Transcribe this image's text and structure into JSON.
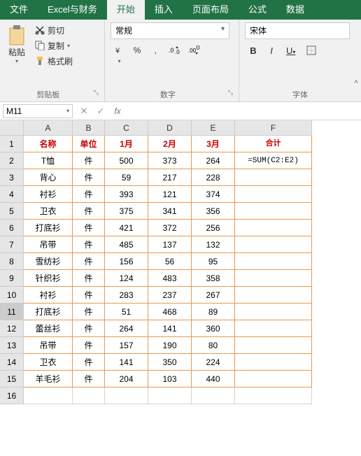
{
  "ribbon": {
    "tabs": [
      "文件",
      "Excel与财务",
      "开始",
      "插入",
      "页面布局",
      "公式",
      "数据"
    ],
    "active_tab_index": 2,
    "clipboard": {
      "paste": "粘贴",
      "cut": "剪切",
      "copy": "复制",
      "format_painter": "格式刷",
      "group_label": "剪贴板"
    },
    "number": {
      "format_select": "常规",
      "group_label": "数字"
    },
    "font": {
      "font_select": "宋体",
      "bold": "B",
      "italic": "I",
      "underline": "U",
      "group_label": "字体"
    }
  },
  "name_box": "M11",
  "formula_input": "",
  "grid": {
    "columns": [
      "A",
      "B",
      "C",
      "D",
      "E",
      "F"
    ],
    "header": [
      "名称",
      "单位",
      "1月",
      "2月",
      "3月",
      "合计"
    ],
    "rows": [
      [
        "T恤",
        "件",
        "500",
        "373",
        "264",
        "=SUM(C2:E2)"
      ],
      [
        "背心",
        "件",
        "59",
        "217",
        "228",
        ""
      ],
      [
        "衬衫",
        "件",
        "393",
        "121",
        "374",
        ""
      ],
      [
        "卫衣",
        "件",
        "375",
        "341",
        "356",
        ""
      ],
      [
        "打底衫",
        "件",
        "421",
        "372",
        "256",
        ""
      ],
      [
        "吊带",
        "件",
        "485",
        "137",
        "132",
        ""
      ],
      [
        "雪纺衫",
        "件",
        "156",
        "56",
        "95",
        ""
      ],
      [
        "针织衫",
        "件",
        "124",
        "483",
        "358",
        ""
      ],
      [
        "衬衫",
        "件",
        "283",
        "237",
        "267",
        ""
      ],
      [
        "打底衫",
        "件",
        "51",
        "468",
        "89",
        ""
      ],
      [
        "蕾丝衫",
        "件",
        "264",
        "141",
        "360",
        ""
      ],
      [
        "吊带",
        "件",
        "157",
        "190",
        "80",
        ""
      ],
      [
        "卫衣",
        "件",
        "141",
        "350",
        "224",
        ""
      ],
      [
        "羊毛衫",
        "件",
        "204",
        "103",
        "440",
        ""
      ]
    ],
    "empty_row_label": "16",
    "selected_row_index": 11
  },
  "chart_data": {
    "type": "table",
    "title": "",
    "columns": [
      "名称",
      "单位",
      "1月",
      "2月",
      "3月",
      "合计"
    ],
    "data": [
      {
        "名称": "T恤",
        "单位": "件",
        "1月": 500,
        "2月": 373,
        "3月": 264,
        "合计": "=SUM(C2:E2)"
      },
      {
        "名称": "背心",
        "单位": "件",
        "1月": 59,
        "2月": 217,
        "3月": 228,
        "合计": null
      },
      {
        "名称": "衬衫",
        "单位": "件",
        "1月": 393,
        "2月": 121,
        "3月": 374,
        "合计": null
      },
      {
        "名称": "卫衣",
        "单位": "件",
        "1月": 375,
        "2月": 341,
        "3月": 356,
        "合计": null
      },
      {
        "名称": "打底衫",
        "单位": "件",
        "1月": 421,
        "2月": 372,
        "3月": 256,
        "合计": null
      },
      {
        "名称": "吊带",
        "单位": "件",
        "1月": 485,
        "2月": 137,
        "3月": 132,
        "合计": null
      },
      {
        "名称": "雪纺衫",
        "单位": "件",
        "1月": 156,
        "2月": 56,
        "3月": 95,
        "合计": null
      },
      {
        "名称": "针织衫",
        "单位": "件",
        "1月": 124,
        "2月": 483,
        "3月": 358,
        "合计": null
      },
      {
        "名称": "衬衫",
        "单位": "件",
        "1月": 283,
        "2月": 237,
        "3月": 267,
        "合计": null
      },
      {
        "名称": "打底衫",
        "单位": "件",
        "1月": 51,
        "2月": 468,
        "3月": 89,
        "合计": null
      },
      {
        "名称": "蕾丝衫",
        "单位": "件",
        "1月": 264,
        "2月": 141,
        "3月": 360,
        "合计": null
      },
      {
        "名称": "吊带",
        "单位": "件",
        "1月": 157,
        "2月": 190,
        "3月": 80,
        "合计": null
      },
      {
        "名称": "卫衣",
        "单位": "件",
        "1月": 141,
        "2月": 350,
        "3月": 224,
        "合计": null
      },
      {
        "名称": "羊毛衫",
        "单位": "件",
        "1月": 204,
        "2月": 103,
        "3月": 440,
        "合计": null
      }
    ]
  }
}
